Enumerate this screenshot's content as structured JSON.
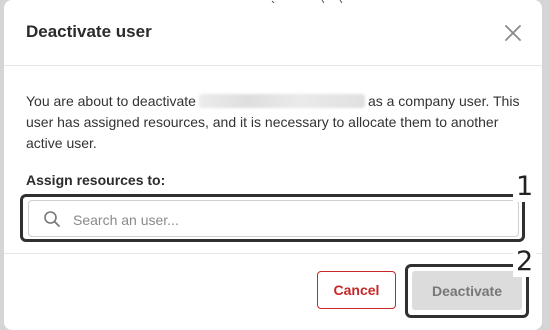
{
  "dialog": {
    "title": "Deactivate user",
    "body_prefix": "You are about to deactivate",
    "body_suffix": "as a company user. This user has assigned resources, and it is necessary to allocate them to another active user.",
    "assign_label": "Assign resources to:",
    "search": {
      "placeholder": "Search an user...",
      "value": ""
    },
    "buttons": {
      "cancel": "Cancel",
      "deactivate": "Deactivate"
    }
  },
  "annotations": [
    "1",
    "2"
  ],
  "colors": {
    "danger": "#c62828",
    "disabled_bg": "#dcdcdc",
    "disabled_text": "#777777"
  },
  "icons": [
    "close-icon",
    "search-icon"
  ]
}
